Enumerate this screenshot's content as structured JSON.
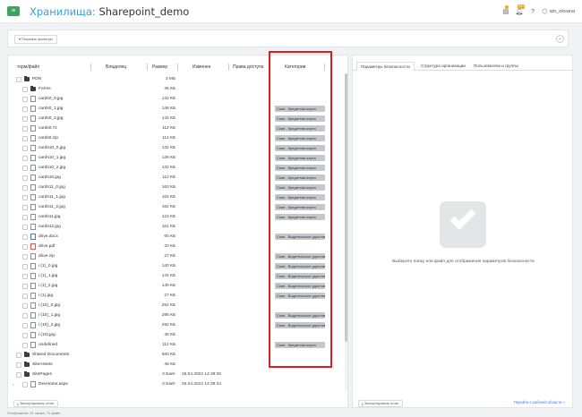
{
  "header": {
    "title_prefix": "Хранилища:",
    "title_name": "Sharepoint_demo",
    "badge_count": "99+",
    "user_name": "am_oksana",
    "icons": [
      "hamburger-icon",
      "clipboard-icon",
      "bell-icon",
      "help-icon",
      "user-icon"
    ]
  },
  "filters": {
    "show_filters_label": "Показать фильтры"
  },
  "table": {
    "columns": {
      "name": "торм/файл",
      "owner": "Владелец",
      "size": "Размер",
      "modified": "Изменен",
      "access": "Права доступа",
      "categories": "Категории"
    },
    "rows": [
      {
        "level": 0,
        "type": "folder",
        "name": "PDN",
        "size": "3 МБ",
        "date": "",
        "category": ""
      },
      {
        "level": 1,
        "type": "folder",
        "name": "Forms",
        "size": "36 КБ",
        "date": "",
        "category": ""
      },
      {
        "level": 1,
        "type": "file",
        "name": "cards0_0.jpg",
        "size": "142 КБ",
        "date": "",
        "category": ""
      },
      {
        "level": 1,
        "type": "file",
        "name": "cards0_1.jpg",
        "size": "146 КБ",
        "date": "",
        "category": "Скан - Кредитная карта"
      },
      {
        "level": 1,
        "type": "file",
        "name": "cards0_2.jpg",
        "size": "142 КБ",
        "date": "",
        "category": "Скан - Кредитная карта"
      },
      {
        "level": 1,
        "type": "file",
        "name": "cards0.7z",
        "size": "112 КБ",
        "date": "",
        "category": "Скан - Кредитная карта"
      },
      {
        "level": 1,
        "type": "file",
        "name": "cards0.zip",
        "size": "112 КБ",
        "date": "",
        "category": "Скан - Кредитная карта"
      },
      {
        "level": 1,
        "type": "file",
        "name": "cards10_0.jpg",
        "size": "132 КБ",
        "date": "",
        "category": "Скан - Кредитная карта"
      },
      {
        "level": 1,
        "type": "file",
        "name": "cards10_1.jpg",
        "size": "128 КБ",
        "date": "",
        "category": "Скан - Кредитная карта"
      },
      {
        "level": 1,
        "type": "file",
        "name": "cards10_2.jpg",
        "size": "132 КБ",
        "date": "",
        "category": "Скан - Кредитная карта"
      },
      {
        "level": 1,
        "type": "file",
        "name": "cards10.jpg",
        "size": "110 КБ",
        "date": "",
        "category": "Скан - Кредитная карта"
      },
      {
        "level": 1,
        "type": "file",
        "name": "cards11_0.jpg",
        "size": "163 КБ",
        "date": "",
        "category": "Скан - Кредитная карта"
      },
      {
        "level": 1,
        "type": "file",
        "name": "cards11_1.jpg",
        "size": "162 КБ",
        "date": "",
        "category": "Скан - Кредитная карта"
      },
      {
        "level": 1,
        "type": "file",
        "name": "cards11_2.jpg",
        "size": "162 КБ",
        "date": "",
        "category": "Скан - Кредитная карта"
      },
      {
        "level": 1,
        "type": "file",
        "name": "cards11.jpg",
        "size": "123 КБ",
        "date": "",
        "category": "Скан - Кредитная карта"
      },
      {
        "level": 1,
        "type": "file",
        "name": "cards12.jpg",
        "size": "161 КБ",
        "date": "",
        "category": ""
      },
      {
        "level": 1,
        "type": "doc",
        "name": "drive.docx",
        "size": "60 КБ",
        "date": "",
        "category": "Скан - Водительское удостоверение"
      },
      {
        "level": 1,
        "type": "pdf",
        "name": "drive.pdf",
        "size": "33 КБ",
        "date": "",
        "category": ""
      },
      {
        "level": 1,
        "type": "file",
        "name": "drive.zip",
        "size": "27 КБ",
        "date": "",
        "category": "Скан - Водительское удостоверение"
      },
      {
        "level": 1,
        "type": "file",
        "name": "i (1)_0.jpg",
        "size": "140 КБ",
        "date": "",
        "category": "Скан - Водительское удостоверение"
      },
      {
        "level": 1,
        "type": "file",
        "name": "i (1)_1.jpg",
        "size": "144 КБ",
        "date": "",
        "category": "Скан - Водительское удостоверение"
      },
      {
        "level": 1,
        "type": "file",
        "name": "i (1)_2.jpg",
        "size": "140 КБ",
        "date": "",
        "category": "Скан - Водительское удостоверение"
      },
      {
        "level": 1,
        "type": "file",
        "name": "i (1).jpg",
        "size": "27 КБ",
        "date": "",
        "category": "Скан - Водительское удостоверение"
      },
      {
        "level": 1,
        "type": "file",
        "name": "i (10)_0.jpg",
        "size": "292 КБ",
        "date": "",
        "category": ""
      },
      {
        "level": 1,
        "type": "file",
        "name": "i (10)_1.jpg",
        "size": "295 КБ",
        "date": "",
        "category": "Скан - Водительское удостоверение"
      },
      {
        "level": 1,
        "type": "file",
        "name": "i (10)_2.jpg",
        "size": "292 КБ",
        "date": "",
        "category": "Скан - Водительское удостоверение"
      },
      {
        "level": 1,
        "type": "file",
        "name": "i (10).jpg",
        "size": "48 КБ",
        "date": "",
        "category": ""
      },
      {
        "level": 1,
        "type": "file",
        "name": "undefined",
        "size": "112 КБ",
        "date": "",
        "category": "Скан - Кредитная карта"
      },
      {
        "level": 0,
        "type": "folder",
        "name": "Shared Documents",
        "size": "580 КБ",
        "date": "",
        "category": ""
      },
      {
        "level": 0,
        "type": "folder",
        "name": "SiteAssets",
        "size": "46 КБ",
        "date": "",
        "category": ""
      },
      {
        "level": 0,
        "type": "folder",
        "name": "SitePages",
        "size": "0 Байт",
        "date": "26.04.2022 14:39:36",
        "category": ""
      },
      {
        "level": 1,
        "type": "file",
        "name": "DevHome.aspx",
        "size": "0 Байт",
        "date": "26.04.2022 14:39:34",
        "category": ""
      }
    ],
    "export_label": "Экспортировать отчет"
  },
  "right_panel": {
    "tabs": [
      "Параметры безопасности",
      "Структура организации",
      "Пользователи и группы"
    ],
    "placeholder_text": "Выберите папку или файл для отображения параметров безопасности",
    "export_label": "Экспортировать отчет",
    "go_link": "Перейти к рабочей области »"
  },
  "footer": {
    "status": "Отображено: 21 папка, 71 файл"
  }
}
